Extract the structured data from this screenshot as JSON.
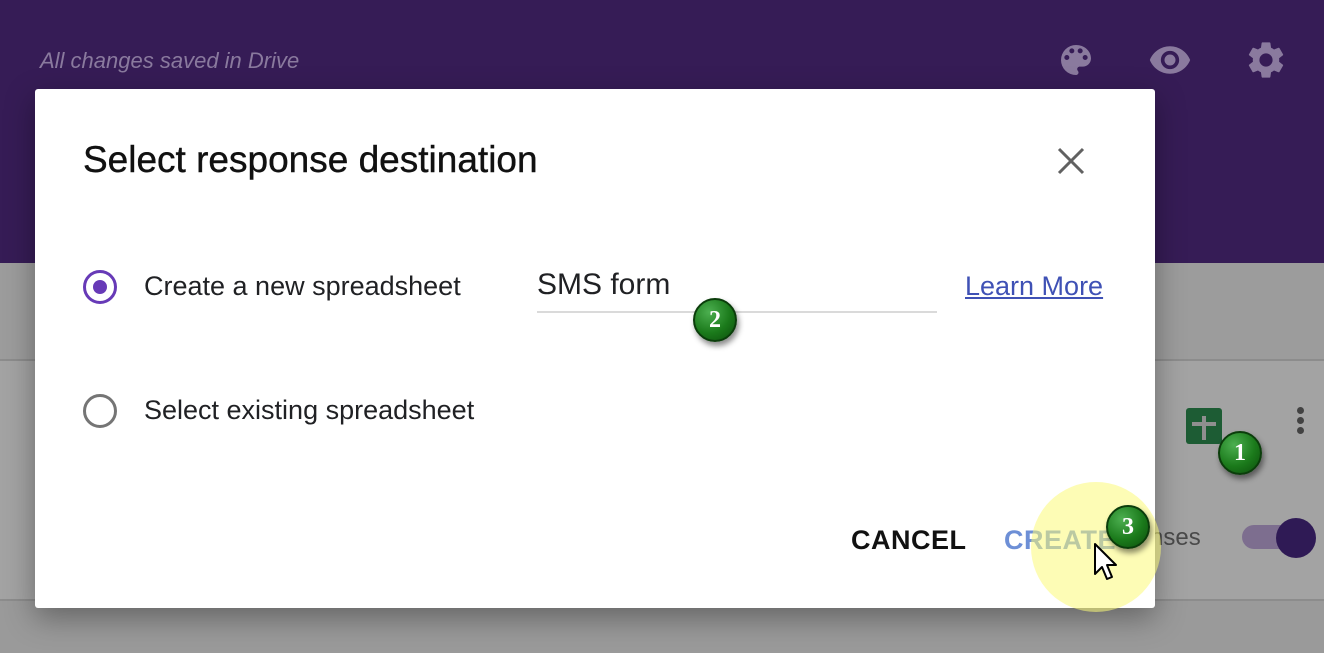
{
  "header": {
    "save_status": "All changes saved in Drive",
    "icons": [
      "palette-icon",
      "eye-icon",
      "gear-icon"
    ]
  },
  "background": {
    "responses_toggle_label": "nses"
  },
  "dialog": {
    "title": "Select response destination",
    "option_new": "Create a new spreadsheet",
    "option_existing": "Select existing spreadsheet",
    "selected_option": "option_new",
    "spreadsheet_name": "SMS form",
    "learn_more": "Learn More",
    "cancel_label": "CANCEL",
    "create_label": "CREATE"
  },
  "annotations": {
    "step1": "1",
    "step2": "2",
    "step3": "3"
  },
  "colors": {
    "header_bg": "#361c56",
    "accent": "#673ab7",
    "link": "#3f51b5",
    "create_button": "#6d8fd6",
    "badge_green": "#1b7a1b"
  }
}
